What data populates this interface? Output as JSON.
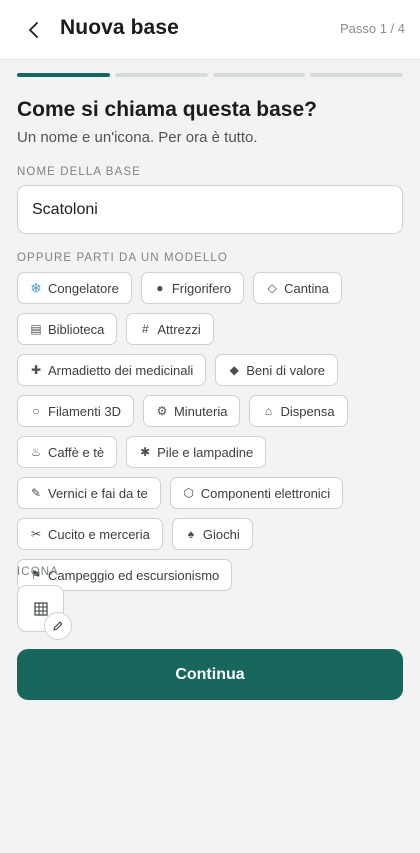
{
  "header": {
    "title": "Nuova base",
    "step": "Passo 1 / 4",
    "back_icon": "chevron-left-icon"
  },
  "progress": {
    "total_steps": 4,
    "current_step": 1,
    "accent": "#17675d",
    "inactive": "#d6dcd9"
  },
  "intro": {
    "heading": "Come si chiama questa base?",
    "subheading": "Un nome e un'icona. Per ora è tutto."
  },
  "name_field": {
    "label": "NOME DELLA BASE",
    "value": "Scatoloni"
  },
  "templates": {
    "label": "OPPURE PARTI DA UN MODELLO",
    "items": [
      {
        "icon": "snowflake-icon",
        "glyph": "❄",
        "label": "Congelatore"
      },
      {
        "icon": "dot-icon",
        "glyph": "●",
        "label": "Frigorifero"
      },
      {
        "icon": "diamond-outline-icon",
        "glyph": "◇",
        "label": "Cantina"
      },
      {
        "icon": "book-icon",
        "glyph": "▤",
        "label": "Biblioteca"
      },
      {
        "icon": "hash-icon",
        "glyph": "#",
        "label": "Attrezzi"
      },
      {
        "icon": "plus-icon",
        "glyph": "✚",
        "label": "Armadietto dei medicinali"
      },
      {
        "icon": "diamond-icon",
        "glyph": "◆",
        "label": "Beni di valore"
      },
      {
        "icon": "circle-icon",
        "glyph": "○",
        "label": "Filamenti 3D"
      },
      {
        "icon": "gear-icon",
        "glyph": "⚙",
        "label": "Minuteria"
      },
      {
        "icon": "house-icon",
        "glyph": "⌂",
        "label": "Dispensa"
      },
      {
        "icon": "hot-drink-icon",
        "glyph": "♨",
        "label": "Caffè e tè"
      },
      {
        "icon": "asterisk-icon",
        "glyph": "✱",
        "label": "Pile e lampadine"
      },
      {
        "icon": "brush-icon",
        "glyph": "✎",
        "label": "Vernici e fai da te"
      },
      {
        "icon": "hexagon-icon",
        "glyph": "⬡",
        "label": "Componenti elettronici"
      },
      {
        "icon": "scissors-icon",
        "glyph": "✂",
        "label": "Cucito e merceria"
      },
      {
        "icon": "spade-icon",
        "glyph": "♠",
        "label": "Giochi"
      },
      {
        "icon": "flag-icon",
        "glyph": "⚑",
        "label": "Campeggio ed escursionismo"
      }
    ]
  },
  "icon_picker": {
    "label": "ICONA",
    "selected_icon": "grid-icon",
    "edit_icon": "pencil-icon"
  },
  "continue_button": {
    "label": "Continua"
  }
}
